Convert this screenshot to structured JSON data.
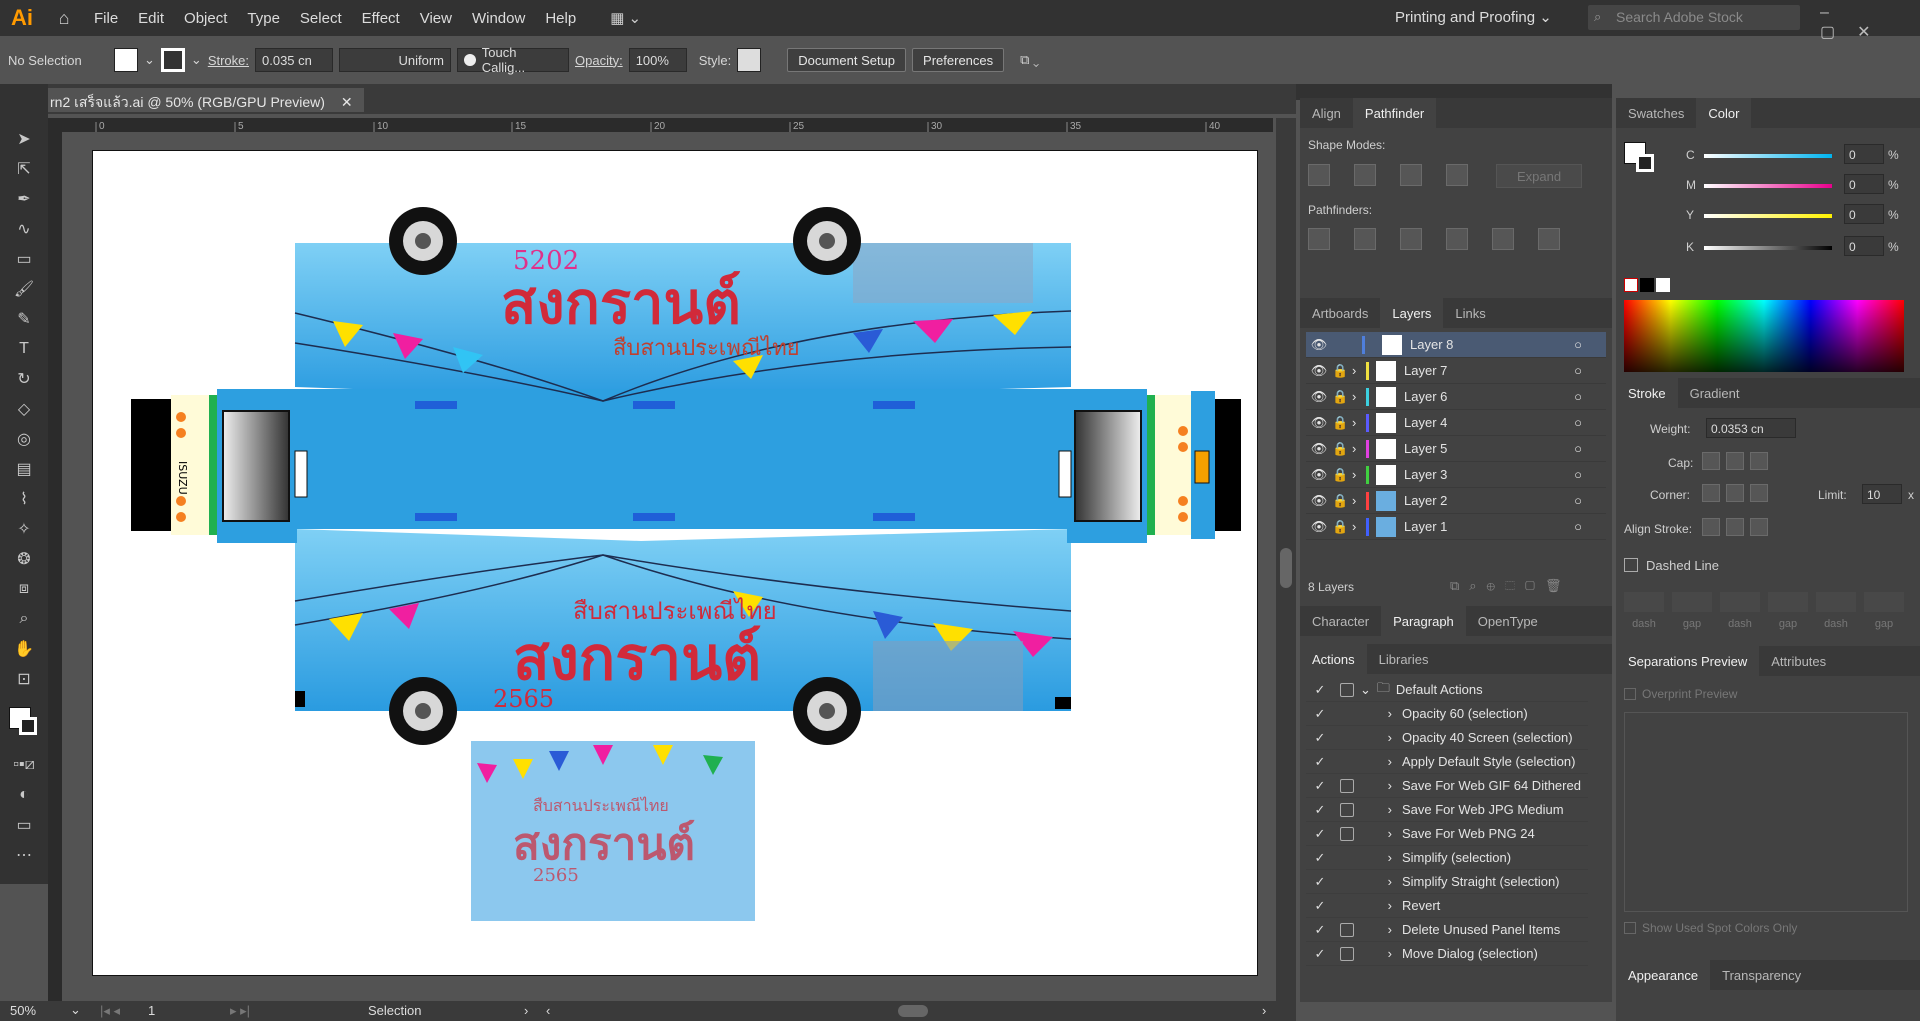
{
  "app": {
    "logo": "Ai"
  },
  "menu": [
    "File",
    "Edit",
    "Object",
    "Type",
    "Select",
    "Effect",
    "View",
    "Window",
    "Help"
  ],
  "workspace": "Printing and Proofing",
  "search": {
    "placeholder": "Search Adobe Stock"
  },
  "control": {
    "selection": "No Selection",
    "stroke_label": "Stroke:",
    "stroke_value": "0.035 cn",
    "profile": "Uniform",
    "brush": "Touch Callig...",
    "opacity_label": "Opacity:",
    "opacity_value": "100%",
    "style_label": "Style:",
    "doc_setup": "Document Setup",
    "preferences": "Preferences"
  },
  "document": {
    "tab_title": "rn2 เสร็จแล้ว.ai @ 50% (RGB/GPU Preview)"
  },
  "ruler": {
    "ticks": [
      "0",
      "5",
      "10",
      "15",
      "20",
      "25",
      "30",
      "35",
      "40"
    ]
  },
  "artwork": {
    "top_number": "5202",
    "top_title": "สงกรานต์",
    "top_subtitle": "สืบสานประเพณีไทย",
    "bottom_subtitle": "สืบสานประเพณีไทย",
    "bottom_title": "สงกรานต์",
    "bottom_number": "2565",
    "card_subtitle": "สืบสานประเพณีไทย",
    "card_title": "สงกรานต์",
    "card_number": "2565",
    "brand": "ISUZU"
  },
  "status": {
    "zoom": "50%",
    "page": "1",
    "tool": "Selection"
  },
  "align_panel": {
    "tabs": [
      "Align",
      "Pathfinder"
    ],
    "shape_modes": "Shape Modes:",
    "expand": "Expand",
    "pathfinders": "Pathfinders:"
  },
  "layers_panel": {
    "tabs": [
      "Artboards",
      "Layers",
      "Links"
    ],
    "layers": [
      {
        "name": "Layer 8",
        "color": "#4f7fdc"
      },
      {
        "name": "Layer 7",
        "color": "#f0e040"
      },
      {
        "name": "Layer 6",
        "color": "#3cd0e0"
      },
      {
        "name": "Layer 4",
        "color": "#5a5aff"
      },
      {
        "name": "Layer 5",
        "color": "#e040e0"
      },
      {
        "name": "Layer 3",
        "color": "#40d040"
      },
      {
        "name": "Layer 2",
        "color": "#ff4040"
      },
      {
        "name": "Layer 1",
        "color": "#4060ff"
      }
    ],
    "count": "8 Layers"
  },
  "char_panel": {
    "tabs": [
      "Character",
      "Paragraph",
      "OpenType"
    ]
  },
  "actions_panel": {
    "tabs": [
      "Actions",
      "Libraries"
    ],
    "set": "Default Actions",
    "items": [
      "Opacity 60 (selection)",
      "Opacity 40 Screen (selection)",
      "Apply Default Style (selection)",
      "Save For Web GIF 64 Dithered",
      "Save For Web JPG Medium",
      "Save For Web PNG 24",
      "Simplify (selection)",
      "Simplify Straight (selection)",
      "Revert",
      "Delete Unused Panel Items",
      "Move Dialog (selection)"
    ]
  },
  "color_panel": {
    "tabs": [
      "Swatches",
      "Color"
    ],
    "channels": [
      {
        "name": "C",
        "value": "0"
      },
      {
        "name": "M",
        "value": "0"
      },
      {
        "name": "Y",
        "value": "0"
      },
      {
        "name": "K",
        "value": "0"
      }
    ],
    "unit": "%"
  },
  "stroke_panel": {
    "tabs": [
      "Stroke",
      "Gradient"
    ],
    "weight_label": "Weight:",
    "weight_value": "0.0353 cn",
    "cap_label": "Cap:",
    "corner_label": "Corner:",
    "limit_label": "Limit:",
    "limit_value": "10",
    "limit_unit": "x",
    "align_label": "Align Stroke:",
    "dashed": "Dashed Line",
    "dash_labels": [
      "dash",
      "gap",
      "dash",
      "gap",
      "dash",
      "gap"
    ]
  },
  "sep_panel": {
    "tabs": [
      "Separations Preview",
      "Attributes"
    ],
    "overprint": "Overprint Preview",
    "spot": "Show Used Spot Colors Only"
  },
  "appearance_panel": {
    "tabs": [
      "Appearance",
      "Transparency"
    ]
  }
}
